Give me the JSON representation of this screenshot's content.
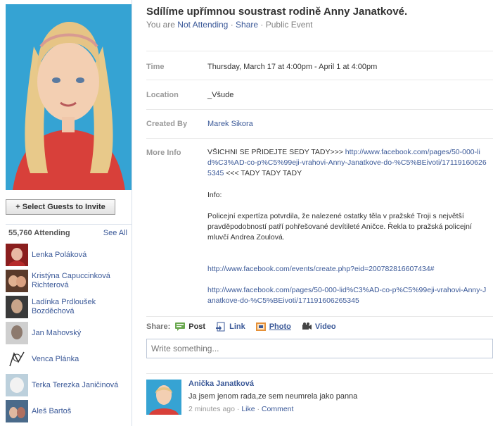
{
  "left": {
    "select_guests": "+ Select Guests to Invite",
    "attending_count": "55,760 Attending",
    "see_all": "See All",
    "guests": [
      {
        "name": "Lenka Poláková"
      },
      {
        "name": "Kristýna Capuccinková Richterová"
      },
      {
        "name": "Ladínka Prdloušek Bozděchová"
      },
      {
        "name": "Jan Mahovský"
      },
      {
        "name": "Venca Plánka"
      },
      {
        "name": "Terka Terezka Janičinová"
      },
      {
        "name": "Aleš Bartoš"
      }
    ]
  },
  "event": {
    "title": "Sdílíme upřímnou soustrast rodině Anny Janatkové.",
    "you_are": "You are",
    "rsvp_status": "Not Attending",
    "sep1": "·",
    "share": "Share",
    "sep2": "·",
    "type": "Public Event"
  },
  "details": {
    "time_label": "Time",
    "time_value": "Thursday, March 17 at 4:00pm - April 1 at 4:00pm",
    "location_label": "Location",
    "location_value": "_Všude",
    "created_label": "Created By",
    "created_value": "Marek Sikora",
    "more_label": "More Info",
    "more_prefix": "VŠICHNI SE PŘIDEJTE SEDY TADY>>> ",
    "more_link1": "http://www.facebook.com/pages/50-000-lid%C3%AD-co-p%C5%99eji-vrahovi-Anny-Janatkove-do-%C5%BEivoti/171191606265345",
    "more_suffix": " <<< TADY TADY TADY",
    "info_heading": "Info:",
    "info_text": "Policejní expertíza potvrdila, že nalezené ostatky těla v pražské Troji s největší pravděpodobností patří pohřešované devítileté Aničce. Řekla to pražská policejní mluvčí Andrea Zoulová.",
    "link2": "http://www.facebook.com/events/create.php?eid=200782816607434#",
    "link3": "http://www.facebook.com/pages/50-000-lid%C3%AD-co-p%C5%99eji-vrahovi-Anny-Janatkove-do-%C5%BEivoti/171191606265345"
  },
  "share_bar": {
    "label": "Share:",
    "post": "Post",
    "link": "Link",
    "photo": "Photo",
    "video": "Video"
  },
  "composer": {
    "placeholder": "Write something..."
  },
  "post": {
    "author": "Anička Janatková",
    "message": "Ja jsem jenom rada,ze sem neumrela jako panna",
    "time": "2 minutes ago",
    "dot1": "·",
    "like": "Like",
    "dot2": "·",
    "comment": "Comment"
  }
}
